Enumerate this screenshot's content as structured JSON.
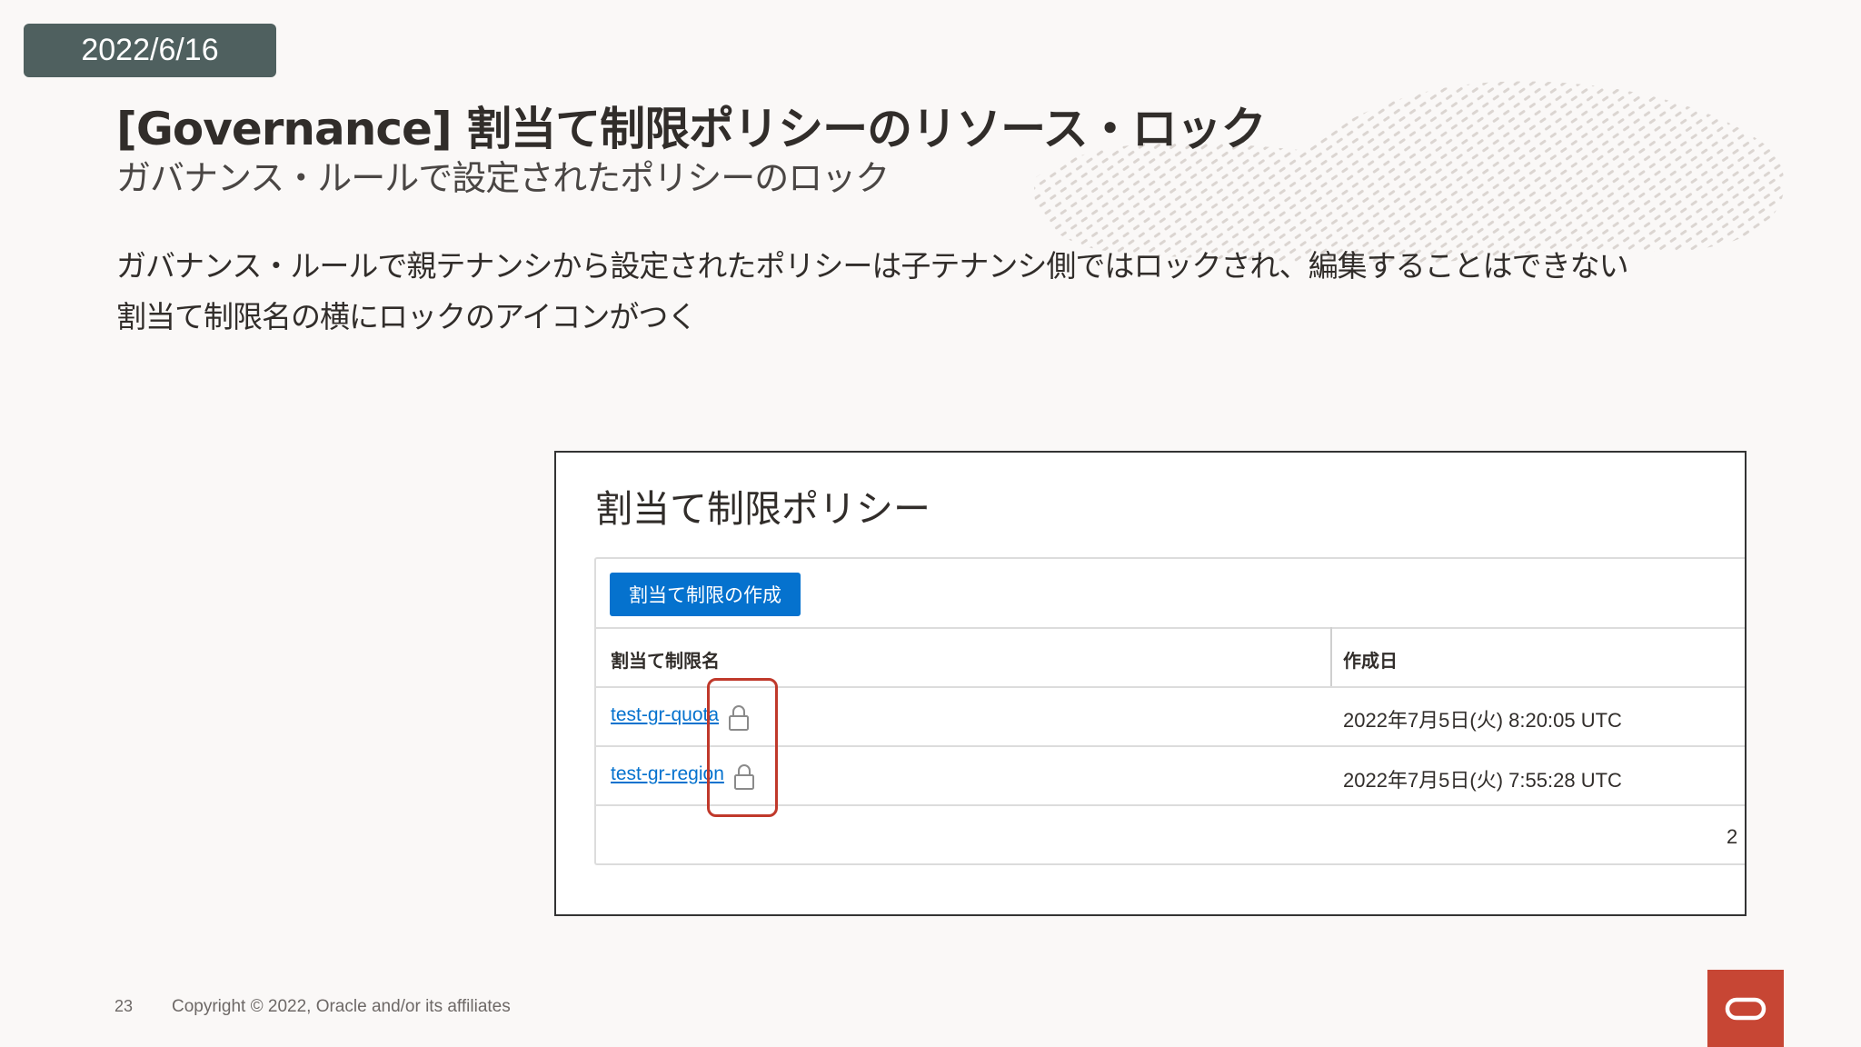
{
  "date": "2022/6/16",
  "title": "[Governance] 割当て制限ポリシーのリソース・ロック",
  "subtitle": "ガバナンス・ルールで設定されたポリシーのロック",
  "body": [
    "ガバナンス・ルールで親テナンシから設定されたポリシーは子テナンシ側ではロックされ、編集することはできない",
    "割当て制限名の横にロックのアイコンがつく"
  ],
  "panel": {
    "title": "割当て制限ポリシー",
    "create_button": "割当て制限の作成",
    "columns": [
      "割当て制限名",
      "作成日"
    ],
    "rows": [
      {
        "name": "test-gr-quota",
        "created": "2022年7月5日(火) 8:20:05 UTC",
        "icon": "lock-icon"
      },
      {
        "name": "test-gr-region",
        "created": "2022年7月5日(火) 7:55:28 UTC",
        "icon": "lock-icon"
      }
    ],
    "pagination_fragment": "2"
  },
  "footer": {
    "page_number": "23",
    "copyright": "Copyright © 2022, Oracle and/or its affiliates"
  },
  "colors": {
    "badge": "#4f605f",
    "primary_button": "#0572ce",
    "link": "#0572ce",
    "highlight": "#c0392b",
    "oracle_red": "#c74634"
  }
}
